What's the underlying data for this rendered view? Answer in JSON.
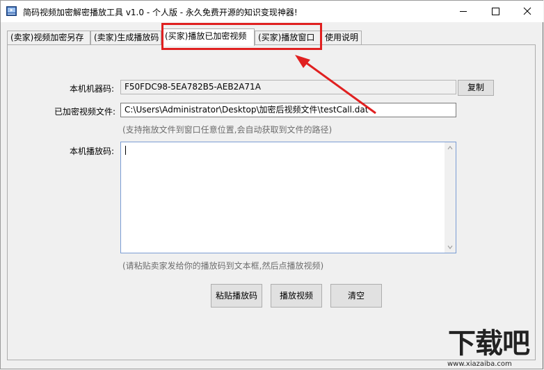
{
  "window": {
    "title": "简码视频加密解密播放工具 v1.0 - 个人版 - 永久免费开源的知识变现神器!",
    "minimize_glyph": "─",
    "maximize_glyph": "☐",
    "close_glyph": "✕"
  },
  "tabs": [
    {
      "label": "(卖家)视频加密另存"
    },
    {
      "label": "(卖家)生成播放码"
    },
    {
      "label": "(买家)播放已加密视频"
    },
    {
      "label": "(买家)播放窗口"
    },
    {
      "label": "使用说明"
    }
  ],
  "form": {
    "machine_code_label": "本机机器码:",
    "machine_code_value": "F50FDC98-5EA782B5-AEB2A71A",
    "copy_button": "复制",
    "encrypted_file_label": "已加密视频文件:",
    "encrypted_file_value": "C:\\Users\\Administrator\\Desktop\\加密后视频文件\\testCall.dat",
    "file_hint": "(支持拖放文件到窗口任意位置,会自动获取到文件的路径)",
    "play_code_label": "本机播放码:",
    "play_code_value": "",
    "play_code_hint": "(请粘贴卖家发给你的播放码到文本框,然后点播放视频)"
  },
  "buttons": {
    "paste": "粘贴播放码",
    "play": "播放视频",
    "clear": "清空"
  },
  "watermark": {
    "big": "下载吧",
    "small": "www.xiazaiba.com"
  },
  "colors": {
    "highlight": "#e02020",
    "hint_text": "#6d6d6d"
  }
}
